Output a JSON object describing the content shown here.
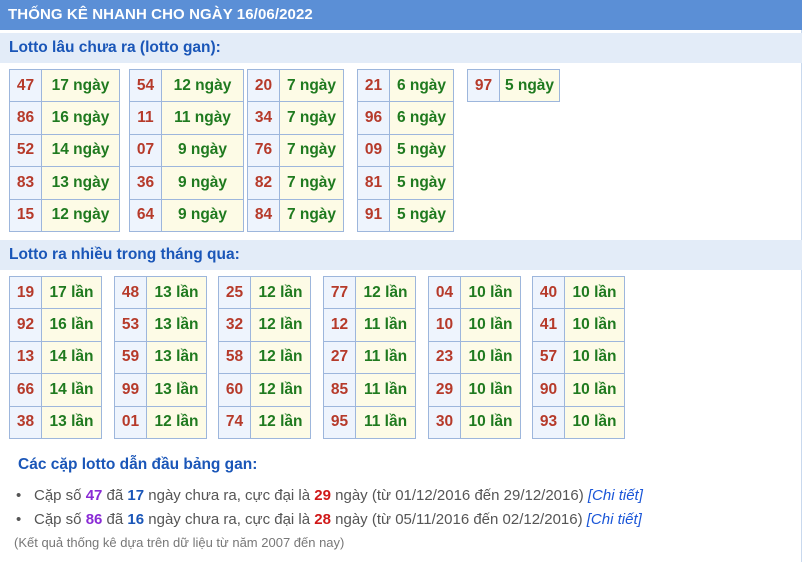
{
  "header": {
    "title": "THỐNG KÊ NHANH CHO NGÀY 16/06/2022"
  },
  "gan": {
    "title": "Lotto lâu chưa ra (lotto gan):",
    "tables": [
      [
        [
          "47",
          "17 ngày"
        ],
        [
          "86",
          "16 ngày"
        ],
        [
          "52",
          "14 ngày"
        ],
        [
          "83",
          "13 ngày"
        ],
        [
          "15",
          "12 ngày"
        ]
      ],
      [
        [
          "54",
          "12 ngày"
        ],
        [
          "11",
          "11 ngày"
        ],
        [
          "07",
          "9 ngày"
        ],
        [
          "36",
          "9 ngày"
        ],
        [
          "64",
          "9 ngày"
        ]
      ],
      [
        [
          "20",
          "7 ngày"
        ],
        [
          "34",
          "7 ngày"
        ],
        [
          "76",
          "7 ngày"
        ],
        [
          "82",
          "7 ngày"
        ],
        [
          "84",
          "7 ngày"
        ]
      ],
      [
        [
          "21",
          "6 ngày"
        ],
        [
          "96",
          "6 ngày"
        ],
        [
          "09",
          "5 ngày"
        ],
        [
          "81",
          "5 ngày"
        ],
        [
          "91",
          "5 ngày"
        ]
      ],
      [
        [
          "97",
          "5 ngày"
        ]
      ]
    ]
  },
  "frequent": {
    "title": "Lotto ra nhiều trong tháng qua:",
    "tables": [
      [
        [
          "19",
          "17 lần"
        ],
        [
          "92",
          "16 lần"
        ],
        [
          "13",
          "14 lần"
        ],
        [
          "66",
          "14 lần"
        ],
        [
          "38",
          "13 lần"
        ]
      ],
      [
        [
          "48",
          "13 lần"
        ],
        [
          "53",
          "13 lần"
        ],
        [
          "59",
          "13 lần"
        ],
        [
          "99",
          "13 lần"
        ],
        [
          "01",
          "12 lần"
        ]
      ],
      [
        [
          "25",
          "12 lần"
        ],
        [
          "32",
          "12 lần"
        ],
        [
          "58",
          "12 lần"
        ],
        [
          "60",
          "12 lần"
        ],
        [
          "74",
          "12 lần"
        ]
      ],
      [
        [
          "77",
          "12 lần"
        ],
        [
          "12",
          "11 lần"
        ],
        [
          "27",
          "11 lần"
        ],
        [
          "85",
          "11 lần"
        ],
        [
          "95",
          "11 lần"
        ]
      ],
      [
        [
          "04",
          "10 lần"
        ],
        [
          "10",
          "10 lần"
        ],
        [
          "23",
          "10 lần"
        ],
        [
          "29",
          "10 lần"
        ],
        [
          "30",
          "10 lần"
        ]
      ],
      [
        [
          "40",
          "10 lần"
        ],
        [
          "41",
          "10 lần"
        ],
        [
          "57",
          "10 lần"
        ],
        [
          "90",
          "10 lần"
        ],
        [
          "93",
          "10 lần"
        ]
      ]
    ]
  },
  "pairs": {
    "title": "Các cặp lotto dẫn đầu bảng gan:",
    "items": [
      {
        "bullet": "•",
        "t1": "Cặp số ",
        "pair": "47",
        "t2": " đã ",
        "days": "17",
        "t3": " ngày chưa ra, cực đại là ",
        "max": "29",
        "t4": " ngày (từ 01/12/2016 đến 29/12/2016) ",
        "link": "[Chi tiết]"
      },
      {
        "bullet": "•",
        "t1": "Cặp số ",
        "pair": "86",
        "t2": " đã ",
        "days": "16",
        "t3": " ngày chưa ra, cực đại là ",
        "max": "28",
        "t4": " ngày (từ 05/11/2016 đến 02/12/2016) ",
        "link": "[Chi tiết]"
      }
    ]
  },
  "note": "(Kết quả thống kê dựa trên dữ liệu từ năm 2007 đến nay)",
  "colors": {
    "header_bg": "#5b8fd6",
    "section_bg": "#e3ecf8",
    "title_blue": "#1a56b8",
    "num_red": "#b63a2a",
    "val_green": "#1f7a1f"
  }
}
